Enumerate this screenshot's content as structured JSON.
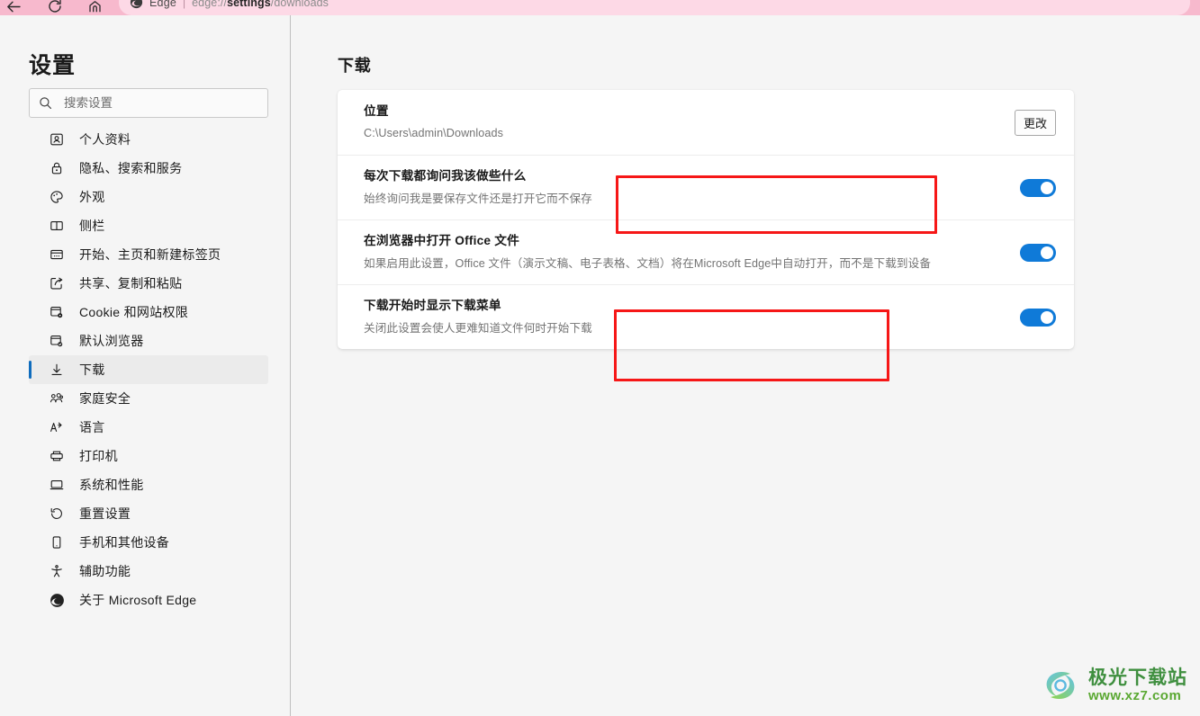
{
  "browser": {
    "back_icon": "back-arrow-icon",
    "reload_icon": "reload-icon",
    "home_icon": "home-icon",
    "favicon": "edge-logo-icon",
    "brand": "Edge",
    "separator": "|",
    "url_prefix": "edge://",
    "url_emphasis": "settings",
    "url_suffix": "/downloads",
    "theme_color": "#f7b9cd",
    "omnibox_color": "#fdd9e6"
  },
  "sidebar": {
    "title": "设置",
    "search": {
      "icon": "search-icon",
      "placeholder": "搜索设置",
      "value": ""
    },
    "items": [
      {
        "label": "个人资料",
        "icon": "profile-icon",
        "selected": false
      },
      {
        "label": "隐私、搜索和服务",
        "icon": "lock-icon",
        "selected": false
      },
      {
        "label": "外观",
        "icon": "palette-icon",
        "selected": false
      },
      {
        "label": "侧栏",
        "icon": "sidebar-panel-icon",
        "selected": false
      },
      {
        "label": "开始、主页和新建标签页",
        "icon": "start-home-newtab-icon",
        "selected": false
      },
      {
        "label": "共享、复制和粘贴",
        "icon": "share-icon",
        "selected": false
      },
      {
        "label": "Cookie 和网站权限",
        "icon": "cookie-permissions-icon",
        "selected": false
      },
      {
        "label": "默认浏览器",
        "icon": "default-browser-icon",
        "selected": false
      },
      {
        "label": "下载",
        "icon": "download-arrow-icon",
        "selected": true
      },
      {
        "label": "家庭安全",
        "icon": "family-safety-icon",
        "selected": false
      },
      {
        "label": "语言",
        "icon": "language-icon",
        "selected": false
      },
      {
        "label": "打印机",
        "icon": "printer-icon",
        "selected": false
      },
      {
        "label": "系统和性能",
        "icon": "monitor-icon",
        "selected": false
      },
      {
        "label": "重置设置",
        "icon": "reset-icon",
        "selected": false
      },
      {
        "label": "手机和其他设备",
        "icon": "phone-icon",
        "selected": false
      },
      {
        "label": "辅助功能",
        "icon": "accessibility-icon",
        "selected": false
      },
      {
        "label": "关于 Microsoft Edge",
        "icon": "edge-logo-icon",
        "selected": false
      }
    ]
  },
  "main": {
    "heading": "下载",
    "rows": [
      {
        "title": "位置",
        "desc": "C:\\Users\\admin\\Downloads",
        "control": "button",
        "button_label": "更改",
        "highlighted": false
      },
      {
        "title": "每次下载都询问我该做些什么",
        "desc": "始终询问我是要保存文件还是打开它而不保存",
        "control": "toggle",
        "toggle_on": true,
        "highlighted": true
      },
      {
        "title": "在浏览器中打开 Office 文件",
        "desc": "如果启用此设置，Office 文件（演示文稿、电子表格、文档）将在Microsoft Edge中自动打开，而不是下载到设备",
        "control": "toggle",
        "toggle_on": true,
        "highlighted": false
      },
      {
        "title": "下载开始时显示下载菜单",
        "desc": "关闭此设置会使人更难知道文件何时开始下载",
        "control": "toggle",
        "toggle_on": true,
        "highlighted": true
      }
    ]
  },
  "annotations": {
    "color": "#f61717",
    "boxes": [
      {
        "id": "hl-1",
        "targets": "每次下载都询问我该做些什么"
      },
      {
        "id": "hl-2",
        "targets": "下载开始时显示下载菜单"
      }
    ]
  },
  "watermark": {
    "logo_icon": "xz7-swirl-logo-icon",
    "title": "极光下载站",
    "url": "www.xz7.com"
  },
  "colors": {
    "accent": "#0f7ad8",
    "selected_indicator": "#0f6cbd",
    "page_background": "#f5f5f5",
    "card_background": "#ffffff"
  }
}
